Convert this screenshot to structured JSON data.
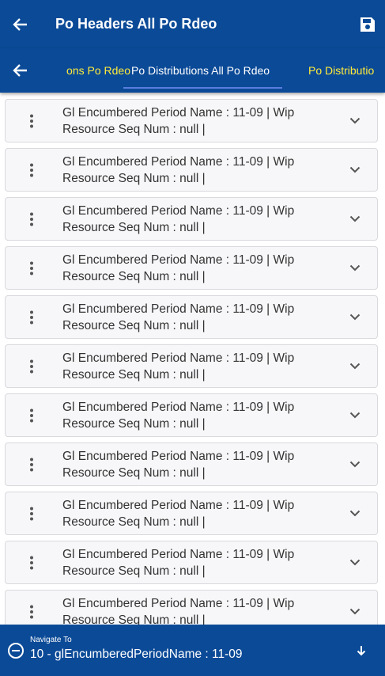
{
  "header": {
    "title": "Po Headers All Po Rdeo",
    "back_icon": "arrow-left-icon",
    "save_icon": "save-icon"
  },
  "tabs": {
    "back_icon": "arrow-left-icon",
    "items": [
      {
        "label": "Po Distributions Po Rdeo",
        "state": "previous",
        "visible_text": "ons Po Rdeo"
      },
      {
        "label": "Po Distributions All Po Rdeo",
        "state": "active"
      },
      {
        "label": "Po Distributions",
        "state": "next",
        "visible_text": "Po Distributio"
      }
    ],
    "inactive_color": "#ffeb3b",
    "active_color": "#ffffff",
    "indicator_color": "#5b7de0"
  },
  "list": {
    "items": [
      {
        "line1": "Gl Encumbered Period Name  : 11-09 | Wip",
        "line2": "Resource Seq Num  : null |"
      },
      {
        "line1": "Gl Encumbered Period Name  : 11-09 | Wip",
        "line2": "Resource Seq Num  : null |"
      },
      {
        "line1": "Gl Encumbered Period Name  : 11-09 | Wip",
        "line2": "Resource Seq Num  : null |"
      },
      {
        "line1": "Gl Encumbered Period Name  : 11-09 | Wip",
        "line2": "Resource Seq Num  : null |"
      },
      {
        "line1": "Gl Encumbered Period Name  : 11-09 | Wip",
        "line2": "Resource Seq Num  : null |"
      },
      {
        "line1": "Gl Encumbered Period Name  : 11-09 | Wip",
        "line2": "Resource Seq Num  : null |"
      },
      {
        "line1": "Gl Encumbered Period Name  : 11-09 | Wip",
        "line2": "Resource Seq Num  : null |"
      },
      {
        "line1": "Gl Encumbered Period Name  : 11-09 | Wip",
        "line2": "Resource Seq Num  : null |"
      },
      {
        "line1": "Gl Encumbered Period Name  : 11-09 | Wip",
        "line2": "Resource Seq Num  : null |"
      },
      {
        "line1": "Gl Encumbered Period Name  : 11-09 | Wip",
        "line2": "Resource Seq Num  : null |"
      },
      {
        "line1": "Gl Encumbered Period Name  : 11-09 | Wip",
        "line2": "Resource Seq Num  : null |"
      }
    ],
    "item_menu_icon": "more-vertical-icon",
    "item_expand_icon": "chevron-down-icon"
  },
  "navigate": {
    "label": "Navigate To",
    "value": "10 - glEncumberedPeriodName : 11-09",
    "collapse_icon": "minus-circle-icon",
    "down_icon": "arrow-down-icon"
  },
  "colors": {
    "primary": "#0b4a97",
    "card_background": "#f7f7f9",
    "card_border": "#d9d9de",
    "text": "#333333"
  }
}
